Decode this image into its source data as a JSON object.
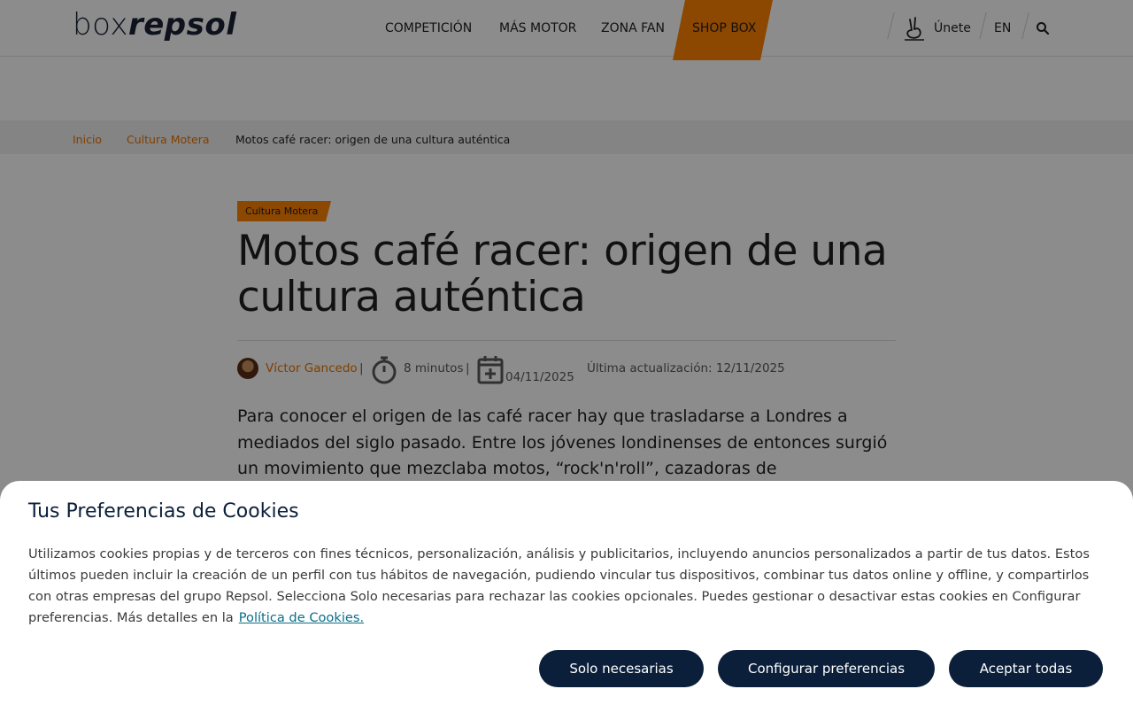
{
  "header": {
    "logo_part1": "box",
    "logo_part2": "repsol",
    "nav": [
      "COMPETICIÓN",
      "MÁS MOTOR",
      "ZONA FAN",
      "SHOP BOX"
    ],
    "join_label": "Únete",
    "lang_label": "EN",
    "icons": [
      "hand-icon",
      "search-icon"
    ]
  },
  "breadcrumb": {
    "items": [
      "Inicio",
      "Cultura Motera",
      "Motos café racer: origen de una cultura auténtica"
    ]
  },
  "article": {
    "category": "Cultura Motera",
    "title": "Motos café racer: origen de una cultura auténtica",
    "author": "Víctor Gancedo",
    "read_time": "8 minutos",
    "published": "04/11/2025",
    "updated": "Última actualización: 12/11/2025",
    "lead": "Para conocer el origen de las café racer hay que trasladarse a Londres a mediados del siglo pasado. Entre los jóvenes londinenses de entonces surgió un movimiento que mezclaba motos, “rock'n'roll”, cazadoras de"
  },
  "cookie_modal": {
    "title": "Tus Preferencias de Cookies",
    "text": "Utilizamos cookies propias y de terceros con fines técnicos, personalización, análisis y publicitarios, incluyendo anuncios personalizados a partir de tus datos. Estos últimos pueden incluir la creación de un perfil con tus hábitos de navegación, pudiendo vincular tus dispositivos, combinar tus datos online y offline, y compartirlos con otras empresas del grupo Repsol. Selecciona Solo necesarias para rechazar las cookies opcionales. Puedes gestionar o desactivar estas cookies en Configurar preferencias. Más detalles en la",
    "link": "Política de Cookies.",
    "buttons": {
      "necessary": "Solo necesarias",
      "configure": "Configurar preferencias",
      "accept": "Aceptar todas"
    }
  },
  "colors": {
    "brand_orange": "#ff8200",
    "link_orange": "#e87300",
    "navy": "#0b1f3a",
    "cookie_link": "#0a6e8a"
  }
}
